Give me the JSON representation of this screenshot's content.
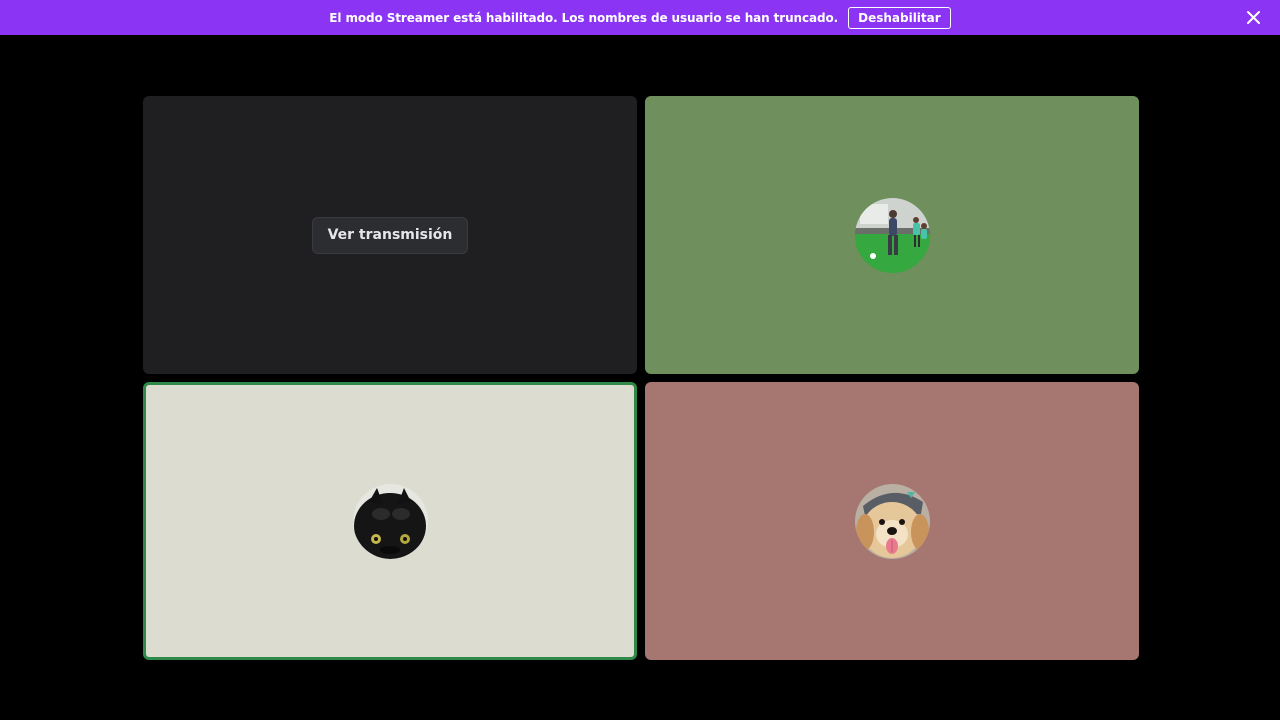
{
  "banner": {
    "message": "El modo Streamer está habilitado. Los nombres de usuario se han truncado.",
    "disable_label": "Deshabilitar",
    "close_icon": "close-icon",
    "background": "#8b34f3"
  },
  "tiles": [
    {
      "type": "stream",
      "watch_label": "Ver transmisión",
      "background": "#1f1f22"
    },
    {
      "type": "participant",
      "avatar": "avatar-soccer-players",
      "background": "#6f905d"
    },
    {
      "type": "participant",
      "avatar": "avatar-black-dragon",
      "background": "#dcddd0",
      "speaking": true,
      "border_color": "#2f8a4a"
    },
    {
      "type": "participant",
      "avatar": "avatar-golden-dog",
      "background": "#a57770"
    }
  ]
}
